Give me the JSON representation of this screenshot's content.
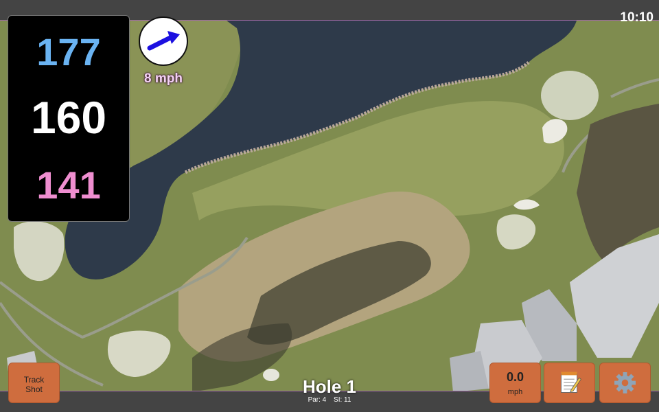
{
  "clock": "10:10",
  "distances": {
    "back": "177",
    "middle": "160",
    "front": "141"
  },
  "wind": {
    "speed": "8 mph",
    "direction_icon": "wind-arrow-icon"
  },
  "hole": {
    "title": "Hole 1",
    "par": "Par: 4",
    "stroke_index": "SI: 11"
  },
  "buttons": {
    "track_line1": "Track",
    "track_line2": "Shot",
    "speed_value": "0.0",
    "speed_unit": "mph",
    "notes_icon": "notepad-icon",
    "settings_icon": "gear-icon"
  },
  "colors": {
    "back_distance": "#6ab3f2",
    "middle_distance": "#ffffff",
    "front_distance": "#ef8ed0",
    "button": "#cf6d3e",
    "wind_text": "#f4d2f4"
  }
}
